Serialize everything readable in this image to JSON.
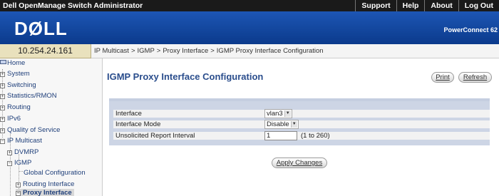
{
  "topbar": {
    "app_title": "Dell OpenManage Switch Administrator",
    "links": [
      "Support",
      "Help",
      "About",
      "Log Out"
    ]
  },
  "header": {
    "logo": "DØLL",
    "model": "PowerConnect 62"
  },
  "ip_address": "10.254.24.161",
  "breadcrumb": [
    "IP Multicast",
    "IGMP",
    "Proxy Interface",
    "IGMP Proxy Interface Configuration"
  ],
  "sidebar": {
    "items": [
      {
        "label": "Home",
        "toggle": ""
      },
      {
        "label": "System",
        "toggle": "+"
      },
      {
        "label": "Switching",
        "toggle": "+"
      },
      {
        "label": "Statistics/RMON",
        "toggle": "+"
      },
      {
        "label": "Routing",
        "toggle": "+"
      },
      {
        "label": "IPv6",
        "toggle": "+"
      },
      {
        "label": "Quality of Service",
        "toggle": "+"
      },
      {
        "label": "IP Multicast",
        "toggle": "−"
      },
      {
        "label": "DVMRP",
        "toggle": "+"
      },
      {
        "label": "IGMP",
        "toggle": "−"
      },
      {
        "label": "Global Configuration",
        "toggle": ""
      },
      {
        "label": "Routing Interface",
        "toggle": "+"
      },
      {
        "label": "Proxy Interface",
        "toggle": "−"
      }
    ]
  },
  "content": {
    "title": "IGMP Proxy Interface Configuration",
    "print_label": "Print",
    "refresh_label": "Refresh",
    "apply_label": "Apply Changes"
  },
  "form": {
    "interface_label": "Interface",
    "interface_value": "vlan3",
    "mode_label": "Interface Mode",
    "mode_value": "Disable",
    "unsolicited_label": "Unsolicited Report Interval",
    "unsolicited_value": "1",
    "unsolicited_hint": "(1 to 260)"
  }
}
